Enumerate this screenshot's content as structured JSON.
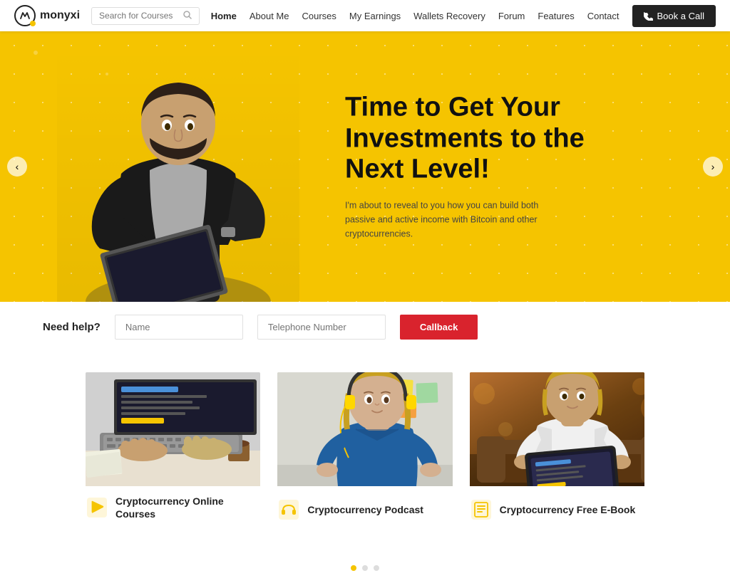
{
  "brand": {
    "name": "monyxi",
    "logo_letter": "m"
  },
  "navbar": {
    "search_placeholder": "Search for Courses",
    "links": [
      {
        "label": "Home",
        "active": true
      },
      {
        "label": "About Me",
        "active": false
      },
      {
        "label": "Courses",
        "active": false
      },
      {
        "label": "My Earnings",
        "active": false
      },
      {
        "label": "Wallets Recovery",
        "active": false
      },
      {
        "label": "Forum",
        "active": false
      },
      {
        "label": "Features",
        "active": false
      },
      {
        "label": "Contact",
        "active": false
      }
    ],
    "cta_label": "Book a Call"
  },
  "hero": {
    "title": "Time to Get Your Investments to the Next Level!",
    "subtitle": "I'm about to reveal to you how you can build both passive and active income with Bitcoin and other cryptocurrencies.",
    "arrow_left": "‹",
    "arrow_right": "›"
  },
  "help": {
    "label": "Need help?",
    "name_placeholder": "Name",
    "phone_placeholder": "Telephone Number",
    "button_label": "Callback"
  },
  "cards": [
    {
      "title": "Cryptocurrency Online Courses",
      "icon_type": "play"
    },
    {
      "title": "Cryptocurrency Podcast",
      "icon_type": "headphones"
    },
    {
      "title": "Cryptocurrency Free E-Book",
      "icon_type": "book"
    }
  ],
  "indicator_dots": 3
}
